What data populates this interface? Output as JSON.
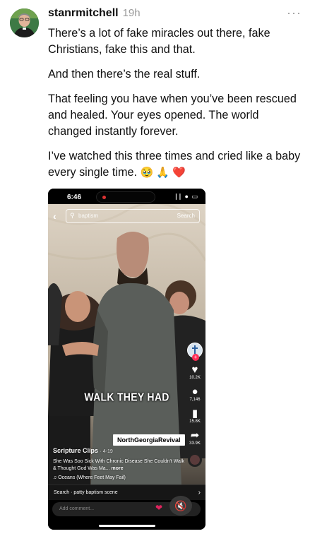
{
  "post": {
    "username": "stanrmitchell",
    "timestamp": "19h",
    "more_label": "···",
    "paragraphs": [
      "There’s a lot of fake miracles out there, fake Christians, fake this and that.",
      "And then there’s the real stuff.",
      "That feeling you have when you’ve been rescued and healed. Your eyes opened. The world changed instantly forever.",
      "I’ve watched this three times and cried like a baby every single time."
    ],
    "emojis": "🥹 🙏 ❤️"
  },
  "video": {
    "status_time": "6:46",
    "status_icons": "∣∣ ● ▭",
    "back_icon": "back-arrow-icon",
    "search_query": "baptism",
    "search_button": "Search",
    "caption_overlay": "WALK THEY HAD",
    "rail": {
      "likes": "10.2K",
      "comments": "7,146",
      "saves": "15.8K",
      "shares": "33.9K"
    },
    "author": "Scripture Clips",
    "date": "· 4-19",
    "description": "She Was Soo Sick With Chronic Disease She Couldn't Walk & Thought God Was Ma...",
    "more_link": "more",
    "sound": "♫ Oceans (Where Feet May Fail)",
    "watermark": "NorthGeorgiaRevival",
    "search_suggestion": "Search · patty baptism scene",
    "comment_placeholder": "Add comment..."
  }
}
